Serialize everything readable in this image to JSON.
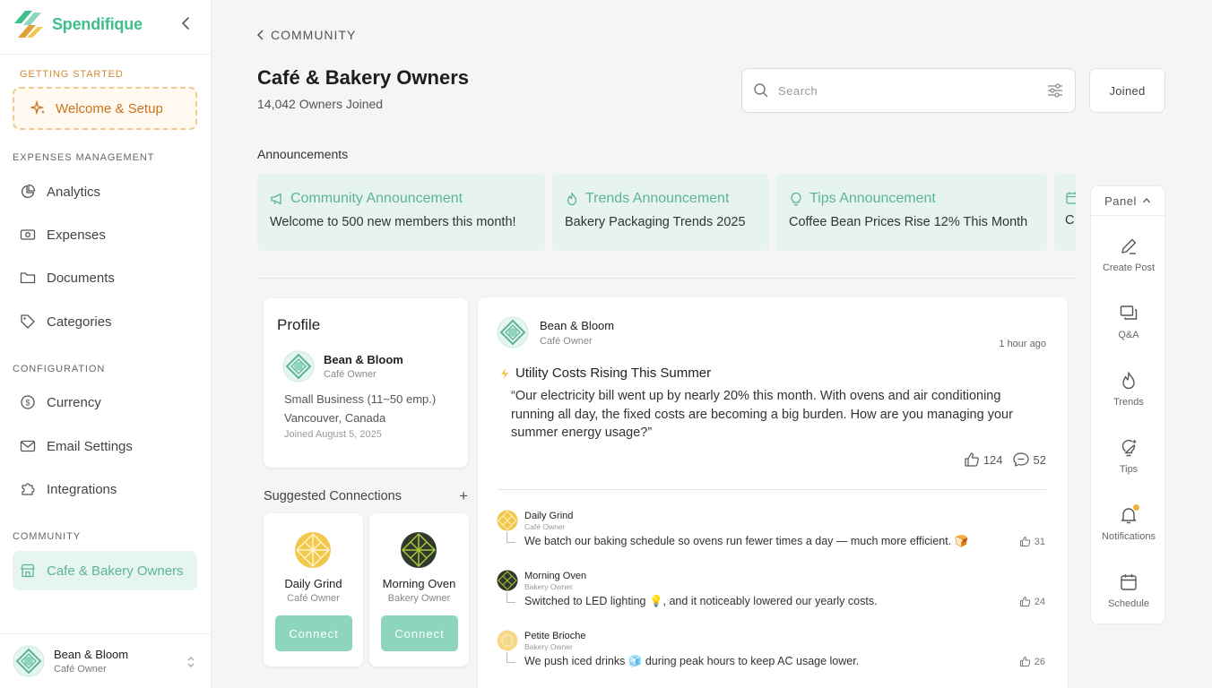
{
  "brand": {
    "name": "Spendifique"
  },
  "sidebar": {
    "getting_started_label": "GETTING STARTED",
    "welcome_label": "Welcome & Setup",
    "expenses_label": "EXPENSES MANAGEMENT",
    "expenses_items": [
      {
        "label": "Analytics",
        "icon": "pie-chart-icon"
      },
      {
        "label": "Expenses",
        "icon": "money-icon"
      },
      {
        "label": "Documents",
        "icon": "folder-icon"
      },
      {
        "label": "Categories",
        "icon": "tag-icon"
      }
    ],
    "configuration_label": "CONFIGURATION",
    "configuration_items": [
      {
        "label": "Currency",
        "icon": "dollar-circle-icon"
      },
      {
        "label": "Email Settings",
        "icon": "mail-icon"
      },
      {
        "label": "Integrations",
        "icon": "puzzle-icon"
      }
    ],
    "community_label": "COMMUNITY",
    "community_items": [
      {
        "label": "Cafe & Bakery Owners",
        "icon": "store-icon",
        "active": true
      }
    ],
    "user": {
      "name": "Bean & Bloom",
      "role": "Café Owner"
    }
  },
  "header": {
    "breadcrumb": "COMMUNITY",
    "title": "Café & Bakery Owners",
    "subtitle": "14,042 Owners Joined",
    "search_placeholder": "Search",
    "joined_label": "Joined"
  },
  "announcements": {
    "label": "Announcements",
    "items": [
      {
        "title": "Community Announcement",
        "text": "Welcome to 500 new members this month!",
        "icon": "megaphone-icon"
      },
      {
        "title": "Trends Announcement",
        "text": "Bakery Packaging Trends 2025",
        "icon": "flame-icon"
      },
      {
        "title": "Tips Announcement",
        "text": "Coffee Bean Prices Rise 12% This Month",
        "icon": "lightbulb-icon"
      },
      {
        "title": "",
        "text": "C",
        "icon": "calendar-icon"
      }
    ]
  },
  "panel": {
    "title": "Panel",
    "items": [
      {
        "label": "Create Post",
        "icon": "pencil-icon"
      },
      {
        "label": "Q&A",
        "icon": "chat-icon"
      },
      {
        "label": "Trends",
        "icon": "flame-icon"
      },
      {
        "label": "Tips",
        "icon": "lightbulb-icon"
      },
      {
        "label": "Notifications",
        "icon": "bell-icon"
      },
      {
        "label": "Schedule",
        "icon": "calendar-icon"
      }
    ]
  },
  "profile": {
    "title": "Profile",
    "name": "Bean & Bloom",
    "role": "Café Owner",
    "business": "Small Business (11~50 emp.)",
    "location": "Vancouver, Canada",
    "joined": "Joined August 5, 2025"
  },
  "suggestions": {
    "title": "Suggested Connections",
    "add_symbol": "+",
    "items": [
      {
        "name": "Daily Grind",
        "role": "Café Owner",
        "button": "Connect",
        "avatar_color": "#f2c84b"
      },
      {
        "name": "Morning Oven",
        "role": "Bakery Owner",
        "button": "Connect",
        "avatar_color": "#2f3a2c"
      }
    ]
  },
  "post": {
    "author": "Bean & Bloom",
    "role": "Café Owner",
    "time": "1 hour ago",
    "title": "Utility Costs Rising This Summer",
    "body": "“Our electricity bill went up by nearly 20% this month. With ovens and air conditioning running all day, the fixed costs are becoming a big burden. How are you managing your summer energy usage?”",
    "likes": "124",
    "comments": "52",
    "replies": [
      {
        "name": "Daily Grind",
        "role": "Café Owner",
        "text": "We batch our baking schedule so ovens run fewer times a day — much more efficient. 🍞",
        "likes": "31",
        "avatar_color": "#f2c84b"
      },
      {
        "name": "Morning Oven",
        "role": "Bakery Owner",
        "text": "Switched to LED lighting 💡, and it noticeably lowered our yearly costs.",
        "likes": "24",
        "avatar_color": "#2f3a2c"
      },
      {
        "name": "Petite Brioche",
        "role": "Bakery Owner",
        "text": "We push iced drinks 🧊 during peak hours to keep AC usage lower.",
        "likes": "26",
        "avatar_color": "#f5d989"
      }
    ]
  },
  "colors": {
    "accent": "#5cb595",
    "brand": "#3fbf8a",
    "welcome": "#c9731d",
    "connect": "#8dd5be"
  }
}
